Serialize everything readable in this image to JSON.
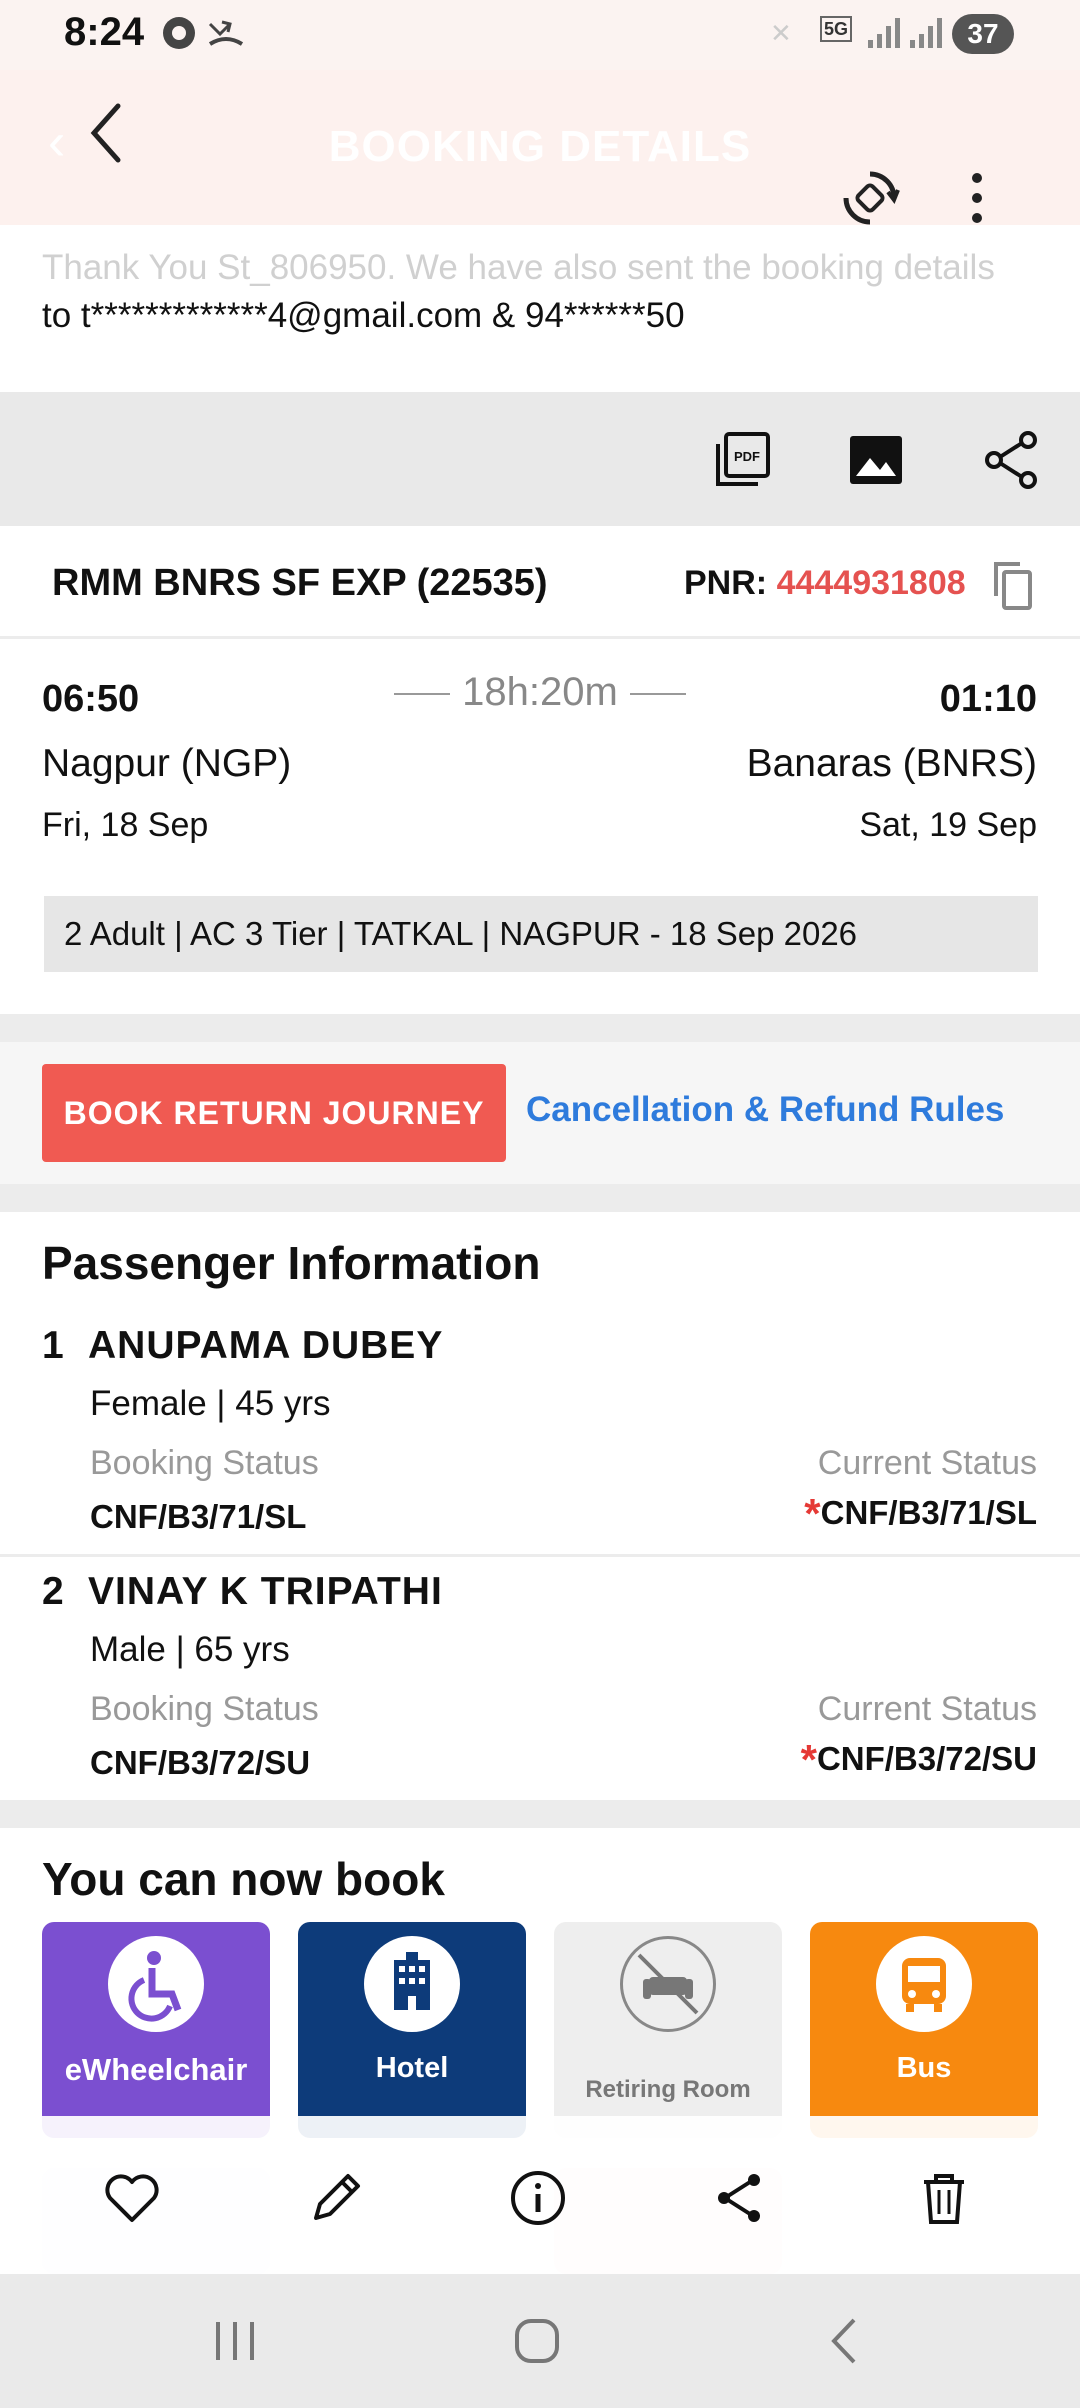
{
  "status_bar": {
    "time": "8:24",
    "network": "5G",
    "battery": "37"
  },
  "header": {
    "title": "BOOKING DETAILS"
  },
  "thank_you": {
    "line1": "Thank You St_806950. We have also sent the booking details",
    "line2": "to t*************4@gmail.com & 94******50"
  },
  "toolbar": {
    "icons": [
      "pdf-icon",
      "image-icon",
      "share-icon"
    ]
  },
  "train": {
    "name": "RMM BNRS SF EXP (22535)",
    "pnr_label": "PNR:",
    "pnr_value": "4444931808"
  },
  "journey": {
    "departure_time": "06:50",
    "arrival_time": "01:10",
    "duration": "18h:20m",
    "from_station": "Nagpur (NGP)",
    "to_station": "Banaras (BNRS)",
    "departure_date": "Fri, 18 Sep",
    "arrival_date": "Sat, 19 Sep",
    "summary": "2 Adult | AC 3 Tier | TATKAL | NAGPUR - 18 Sep 2026"
  },
  "actions": {
    "book_return": "BOOK RETURN JOURNEY",
    "refund_rules": "Cancellation & Refund Rules"
  },
  "passengers": {
    "title": "Passenger Information",
    "booking_status_label": "Booking Status",
    "current_status_label": "Current Status",
    "list": [
      {
        "num": "1",
        "name": "ANUPAMA DUBEY",
        "meta": "Female | 45 yrs",
        "booking_status": "CNF/B3/71/SL",
        "current_status": "CNF/B3/71/SL"
      },
      {
        "num": "2",
        "name": "VINAY K TRIPATHI",
        "meta": "Male | 65 yrs",
        "booking_status": "CNF/B3/72/SU",
        "current_status": "CNF/B3/72/SU"
      }
    ]
  },
  "you_can_book": {
    "title": "You can now book",
    "tiles": [
      {
        "label": "eWheelchair",
        "color": "#7b4fd0"
      },
      {
        "label": "Hotel",
        "color": "#0d3b7a"
      },
      {
        "label": "Retiring Room",
        "color": "#eeeeee"
      },
      {
        "label": "Bus",
        "color": "#f7890f"
      }
    ]
  },
  "bottom_actions": [
    "heart-icon",
    "pencil-icon",
    "info-icon",
    "share-icon",
    "trash-icon"
  ],
  "colors": {
    "accent_red": "#f05a52",
    "pnr_red": "#e55250",
    "link_blue": "#2e7bdc"
  }
}
